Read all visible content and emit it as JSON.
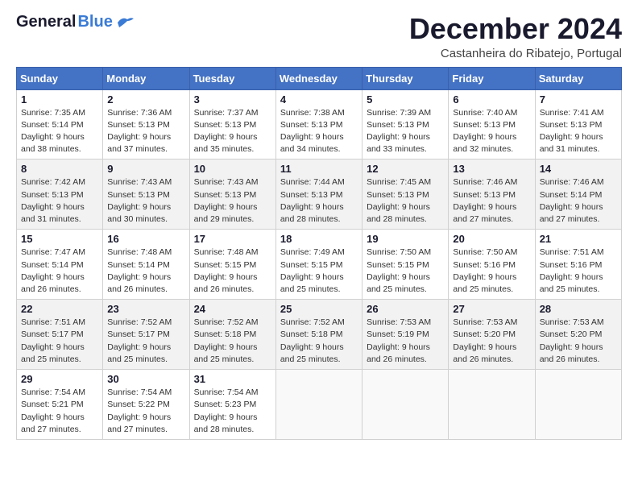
{
  "header": {
    "logo_general": "General",
    "logo_blue": "Blue",
    "month_title": "December 2024",
    "location": "Castanheira do Ribatejo, Portugal"
  },
  "days_of_week": [
    "Sunday",
    "Monday",
    "Tuesday",
    "Wednesday",
    "Thursday",
    "Friday",
    "Saturday"
  ],
  "weeks": [
    [
      {
        "day": "1",
        "info": "Sunrise: 7:35 AM\nSunset: 5:14 PM\nDaylight: 9 hours\nand 38 minutes."
      },
      {
        "day": "2",
        "info": "Sunrise: 7:36 AM\nSunset: 5:13 PM\nDaylight: 9 hours\nand 37 minutes."
      },
      {
        "day": "3",
        "info": "Sunrise: 7:37 AM\nSunset: 5:13 PM\nDaylight: 9 hours\nand 35 minutes."
      },
      {
        "day": "4",
        "info": "Sunrise: 7:38 AM\nSunset: 5:13 PM\nDaylight: 9 hours\nand 34 minutes."
      },
      {
        "day": "5",
        "info": "Sunrise: 7:39 AM\nSunset: 5:13 PM\nDaylight: 9 hours\nand 33 minutes."
      },
      {
        "day": "6",
        "info": "Sunrise: 7:40 AM\nSunset: 5:13 PM\nDaylight: 9 hours\nand 32 minutes."
      },
      {
        "day": "7",
        "info": "Sunrise: 7:41 AM\nSunset: 5:13 PM\nDaylight: 9 hours\nand 31 minutes."
      }
    ],
    [
      {
        "day": "8",
        "info": "Sunrise: 7:42 AM\nSunset: 5:13 PM\nDaylight: 9 hours\nand 31 minutes."
      },
      {
        "day": "9",
        "info": "Sunrise: 7:43 AM\nSunset: 5:13 PM\nDaylight: 9 hours\nand 30 minutes."
      },
      {
        "day": "10",
        "info": "Sunrise: 7:43 AM\nSunset: 5:13 PM\nDaylight: 9 hours\nand 29 minutes."
      },
      {
        "day": "11",
        "info": "Sunrise: 7:44 AM\nSunset: 5:13 PM\nDaylight: 9 hours\nand 28 minutes."
      },
      {
        "day": "12",
        "info": "Sunrise: 7:45 AM\nSunset: 5:13 PM\nDaylight: 9 hours\nand 28 minutes."
      },
      {
        "day": "13",
        "info": "Sunrise: 7:46 AM\nSunset: 5:13 PM\nDaylight: 9 hours\nand 27 minutes."
      },
      {
        "day": "14",
        "info": "Sunrise: 7:46 AM\nSunset: 5:14 PM\nDaylight: 9 hours\nand 27 minutes."
      }
    ],
    [
      {
        "day": "15",
        "info": "Sunrise: 7:47 AM\nSunset: 5:14 PM\nDaylight: 9 hours\nand 26 minutes."
      },
      {
        "day": "16",
        "info": "Sunrise: 7:48 AM\nSunset: 5:14 PM\nDaylight: 9 hours\nand 26 minutes."
      },
      {
        "day": "17",
        "info": "Sunrise: 7:48 AM\nSunset: 5:15 PM\nDaylight: 9 hours\nand 26 minutes."
      },
      {
        "day": "18",
        "info": "Sunrise: 7:49 AM\nSunset: 5:15 PM\nDaylight: 9 hours\nand 25 minutes."
      },
      {
        "day": "19",
        "info": "Sunrise: 7:50 AM\nSunset: 5:15 PM\nDaylight: 9 hours\nand 25 minutes."
      },
      {
        "day": "20",
        "info": "Sunrise: 7:50 AM\nSunset: 5:16 PM\nDaylight: 9 hours\nand 25 minutes."
      },
      {
        "day": "21",
        "info": "Sunrise: 7:51 AM\nSunset: 5:16 PM\nDaylight: 9 hours\nand 25 minutes."
      }
    ],
    [
      {
        "day": "22",
        "info": "Sunrise: 7:51 AM\nSunset: 5:17 PM\nDaylight: 9 hours\nand 25 minutes."
      },
      {
        "day": "23",
        "info": "Sunrise: 7:52 AM\nSunset: 5:17 PM\nDaylight: 9 hours\nand 25 minutes."
      },
      {
        "day": "24",
        "info": "Sunrise: 7:52 AM\nSunset: 5:18 PM\nDaylight: 9 hours\nand 25 minutes."
      },
      {
        "day": "25",
        "info": "Sunrise: 7:52 AM\nSunset: 5:18 PM\nDaylight: 9 hours\nand 25 minutes."
      },
      {
        "day": "26",
        "info": "Sunrise: 7:53 AM\nSunset: 5:19 PM\nDaylight: 9 hours\nand 26 minutes."
      },
      {
        "day": "27",
        "info": "Sunrise: 7:53 AM\nSunset: 5:20 PM\nDaylight: 9 hours\nand 26 minutes."
      },
      {
        "day": "28",
        "info": "Sunrise: 7:53 AM\nSunset: 5:20 PM\nDaylight: 9 hours\nand 26 minutes."
      }
    ],
    [
      {
        "day": "29",
        "info": "Sunrise: 7:54 AM\nSunset: 5:21 PM\nDaylight: 9 hours\nand 27 minutes."
      },
      {
        "day": "30",
        "info": "Sunrise: 7:54 AM\nSunset: 5:22 PM\nDaylight: 9 hours\nand 27 minutes."
      },
      {
        "day": "31",
        "info": "Sunrise: 7:54 AM\nSunset: 5:23 PM\nDaylight: 9 hours\nand 28 minutes."
      },
      {
        "day": "",
        "info": ""
      },
      {
        "day": "",
        "info": ""
      },
      {
        "day": "",
        "info": ""
      },
      {
        "day": "",
        "info": ""
      }
    ]
  ]
}
